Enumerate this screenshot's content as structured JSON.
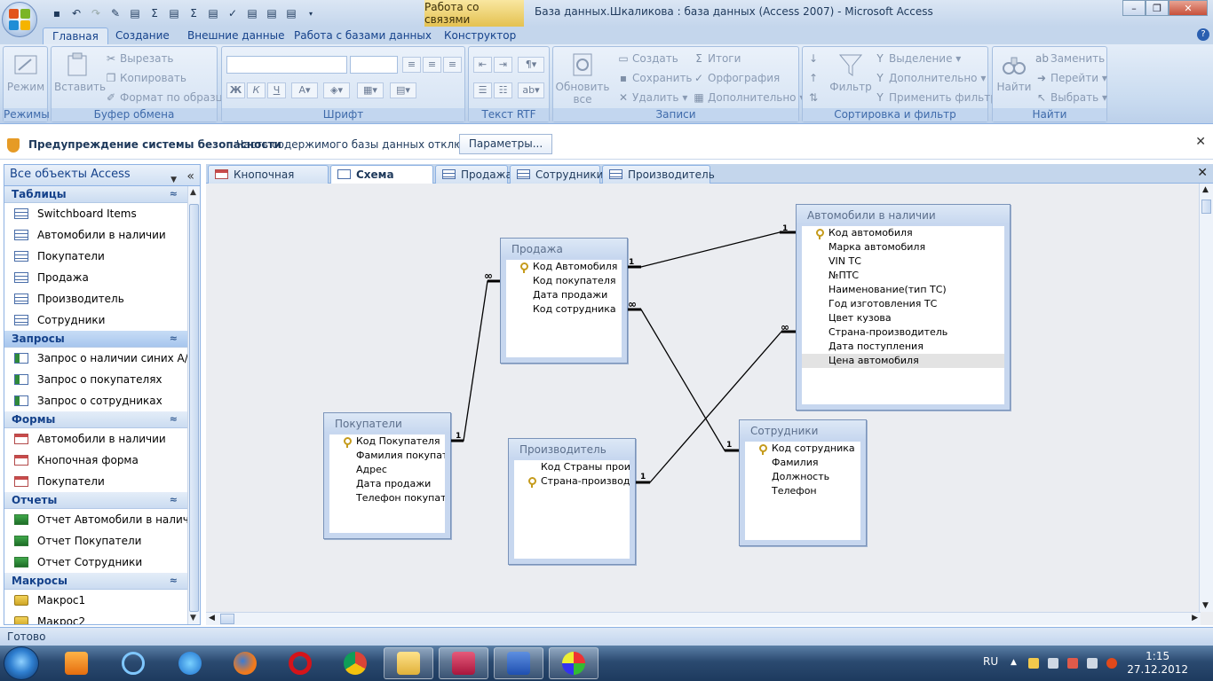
{
  "window": {
    "title": "База данных.Шкаликова : база данных (Access 2007) - Microsoft Access",
    "context_tab": "Работа со связями"
  },
  "ribbon_tabs": [
    "Главная",
    "Создание",
    "Внешние данные",
    "Работа с базами данных",
    "Конструктор"
  ],
  "ribbon": {
    "modes": {
      "view_label": "Режим",
      "group": "Режимы"
    },
    "clipboard": {
      "paste_label": "Вставить",
      "cut": "Вырезать",
      "copy": "Копировать",
      "format_painter": "Формат по образцу",
      "group": "Буфер обмена"
    },
    "font": {
      "group": "Шрифт"
    },
    "rtf": {
      "group": "Текст RTF"
    },
    "records": {
      "refresh_label": "Обновить все",
      "create": "Создать",
      "save": "Сохранить",
      "delete": "Удалить",
      "totals": "Итоги",
      "spelling": "Орфография",
      "more": "Дополнительно",
      "group": "Записи"
    },
    "sort": {
      "filter_label": "Фильтр",
      "selection": "Выделение",
      "advanced": "Дополнительно",
      "apply": "Применить фильтр",
      "group": "Сортировка и фильтр"
    },
    "find": {
      "find_label": "Найти",
      "replace": "Заменить",
      "goto": "Перейти",
      "select": "Выбрать",
      "group": "Найти"
    }
  },
  "security": {
    "title": "Предупреждение системы безопасности",
    "message": "Часть содержимого базы данных отключено",
    "options_button": "Параметры..."
  },
  "nav": {
    "header": "Все объекты Access",
    "sections": [
      {
        "title": "Таблицы",
        "items": [
          "Switchboard Items",
          "Автомобили в наличии",
          "Покупатели",
          "Продажа",
          "Производитель",
          "Сотрудники"
        ]
      },
      {
        "title": "Запросы",
        "items": [
          "Запрос о наличии синих А/М",
          "Запрос о покупателях",
          "Запрос о сотрудниках"
        ]
      },
      {
        "title": "Формы",
        "items": [
          "Автомобили в наличии",
          "Кнопочная форма",
          "Покупатели"
        ]
      },
      {
        "title": "Отчеты",
        "items": [
          "Отчет Автомобили в наличии",
          "Отчет Покупатели",
          "Отчет Сотрудники"
        ]
      },
      {
        "title": "Макросы",
        "items": [
          "Макрос1",
          "Макрос2"
        ]
      }
    ]
  },
  "doc_tabs": [
    "Кнопочная форма",
    "Схема данных",
    "Продажа",
    "Сотрудники",
    "Производитель"
  ],
  "relationships": {
    "prodazha": {
      "title": "Продажа",
      "fields": [
        "Код Автомобиля",
        "Код покупателя",
        "Дата продажи",
        "Код сотрудника"
      ]
    },
    "avto": {
      "title": "Автомобили в наличии",
      "fields": [
        "Код автомобиля",
        "Марка автомобиля",
        "VIN ТС",
        "№ПТС",
        "Наименование(тип ТС)",
        "Год изготовления ТС",
        "Цвет кузова",
        "Страна-производитель",
        "Дата поступления",
        "Цена автомобиля"
      ]
    },
    "pokup": {
      "title": "Покупатели",
      "fields": [
        "Код Покупателя",
        "Фамилия покупате",
        "Адрес",
        "Дата продажи",
        "Телефон покупате"
      ]
    },
    "proizv": {
      "title": "Производитель",
      "fields": [
        "Код Страны произ",
        "Страна-производи"
      ]
    },
    "sotr": {
      "title": "Сотрудники",
      "fields": [
        "Код сотрудника",
        "Фамилия",
        "Должность",
        "Телефон"
      ]
    },
    "one": "1",
    "many": "∞"
  },
  "status": "Готово",
  "tray": {
    "lang": "RU",
    "time": "1:15",
    "date": "27.12.2012"
  }
}
